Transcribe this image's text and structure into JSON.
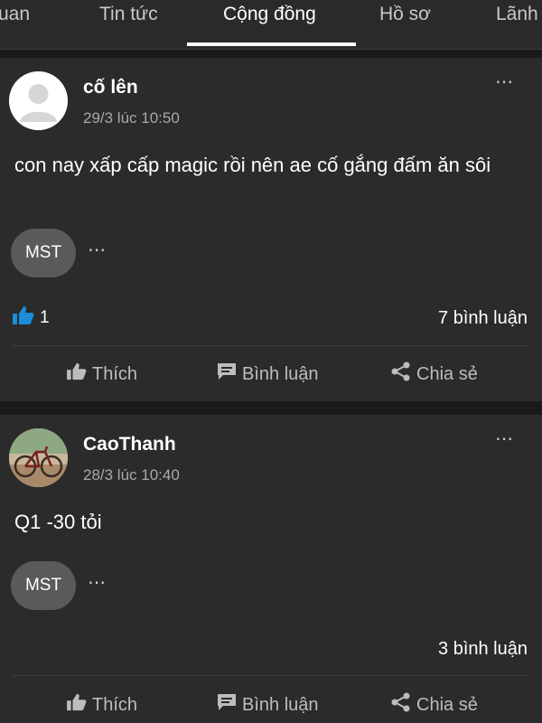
{
  "tabs": [
    {
      "label": "uan"
    },
    {
      "label": "Tin tức"
    },
    {
      "label": "Cộng đồng",
      "active": true
    },
    {
      "label": "Hồ sơ"
    },
    {
      "label": "Lãnh"
    }
  ],
  "posts": [
    {
      "username": "cố lên",
      "time": "29/3 lúc 10:50",
      "content": "con nay xấp cấp magic rồi nên ae cố gắng đấm ăn sôi",
      "tag": "MST",
      "like_count": "1",
      "comments": "7 bình luận",
      "avatar": "default-avatar-icon"
    },
    {
      "username": "CaoThanh",
      "time": "28/3 lúc 10:40",
      "content": "Q1 -30 tỏi",
      "tag": "MST",
      "like_count": "",
      "comments": "3 bình luận",
      "avatar": "bicycle-photo-avatar"
    }
  ],
  "actions": {
    "like": "Thích",
    "comment": "Bình luận",
    "share": "Chia sẻ"
  },
  "more_icon": "⋯",
  "colors": {
    "background": "#1e1e1e",
    "card": "#2b2b2b",
    "like_blue": "#1a8cd8"
  }
}
